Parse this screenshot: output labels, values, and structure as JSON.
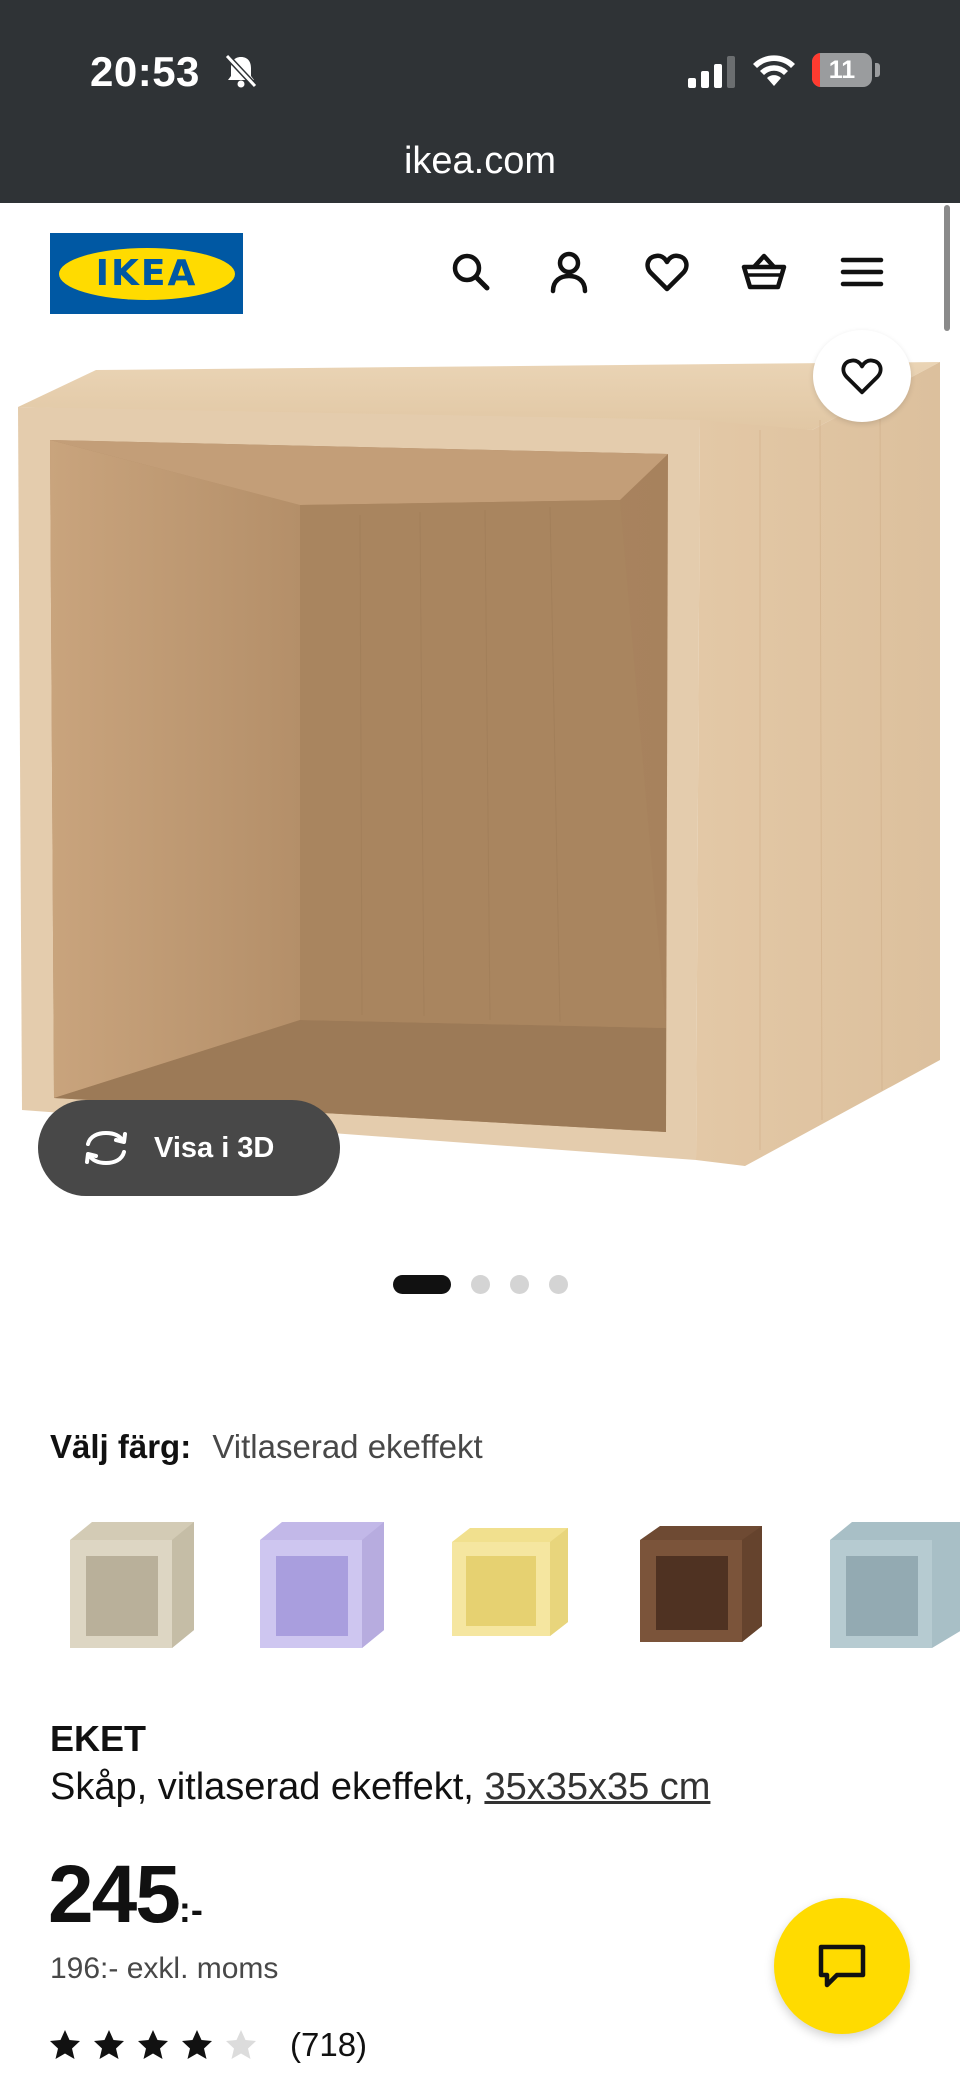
{
  "status_bar": {
    "time": "20:53",
    "battery": "11",
    "icons": [
      "bell-slash-icon",
      "signal-icon",
      "wifi-icon",
      "battery-icon"
    ]
  },
  "browser": {
    "url": "ikea.com"
  },
  "header": {
    "logo_text": "IKEA",
    "icons": [
      "search-icon",
      "user-icon",
      "heart-icon",
      "cart-icon",
      "menu-icon"
    ]
  },
  "product_image": {
    "view_3d_label": "Visa i 3D",
    "slide_count": 4,
    "active_slide": 1
  },
  "color_select": {
    "label": "Välj färg:",
    "selected": "Vitlaserad ekeffekt",
    "swatches": [
      {
        "color": "#d3cbb5"
      },
      {
        "color": "#c2b8e8"
      },
      {
        "color": "#f1e08e"
      },
      {
        "color": "#6e4a33"
      },
      {
        "color": "#a8bfc6"
      }
    ]
  },
  "product": {
    "name": "EKET",
    "description": "Skåp, vitlaserad ekeffekt,",
    "dimensions": "35x35x35 cm",
    "price": "245",
    "price_suffix": ":-",
    "price_ex_vat": "196:- exkl. moms",
    "rating": 4,
    "rating_max": 5,
    "review_count": "(718)"
  },
  "colors": {
    "brand_blue": "#0058a3",
    "brand_yellow": "#ffdb00",
    "chrome": "#2f3336"
  }
}
